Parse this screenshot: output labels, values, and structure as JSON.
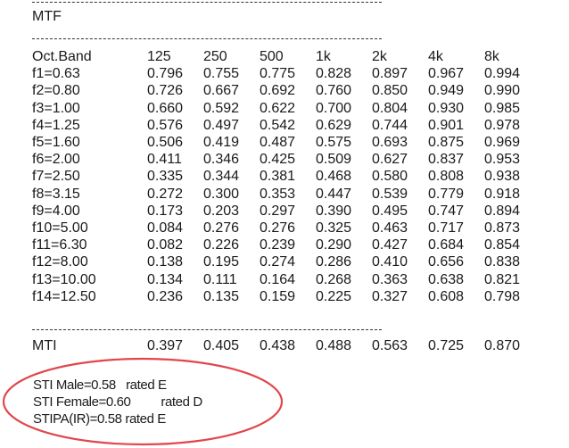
{
  "section_title": "MTF",
  "table": {
    "header": [
      "Oct.Band",
      "125",
      "250",
      "500",
      "1k",
      "2k",
      "4k",
      "8k"
    ],
    "rows": [
      [
        "f1=0.63",
        "0.796",
        "0.755",
        "0.775",
        "0.828",
        "0.897",
        "0.967",
        "0.994"
      ],
      [
        "f2=0.80",
        "0.726",
        "0.667",
        "0.692",
        "0.760",
        "0.850",
        "0.949",
        "0.990"
      ],
      [
        "f3=1.00",
        "0.660",
        "0.592",
        "0.622",
        "0.700",
        "0.804",
        "0.930",
        "0.985"
      ],
      [
        "f4=1.25",
        "0.576",
        "0.497",
        "0.542",
        "0.629",
        "0.744",
        "0.901",
        "0.978"
      ],
      [
        "f5=1.60",
        "0.506",
        "0.419",
        "0.487",
        "0.575",
        "0.693",
        "0.875",
        "0.969"
      ],
      [
        "f6=2.00",
        "0.411",
        "0.346",
        "0.425",
        "0.509",
        "0.627",
        "0.837",
        "0.953"
      ],
      [
        "f7=2.50",
        "0.335",
        "0.344",
        "0.381",
        "0.468",
        "0.580",
        "0.808",
        "0.938"
      ],
      [
        "f8=3.15",
        "0.272",
        "0.300",
        "0.353",
        "0.447",
        "0.539",
        "0.779",
        "0.918"
      ],
      [
        "f9=4.00",
        "0.173",
        "0.203",
        "0.297",
        "0.390",
        "0.495",
        "0.747",
        "0.894"
      ],
      [
        "f10=5.00",
        "0.084",
        "0.276",
        "0.276",
        "0.325",
        "0.463",
        "0.717",
        "0.873"
      ],
      [
        "f11=6.30",
        "0.082",
        "0.226",
        "0.239",
        "0.290",
        "0.427",
        "0.684",
        "0.854"
      ],
      [
        "f12=8.00",
        "0.138",
        "0.195",
        "0.274",
        "0.286",
        "0.410",
        "0.656",
        "0.838"
      ],
      [
        "f13=10.00",
        "0.134",
        "0.111",
        "0.164",
        "0.268",
        "0.363",
        "0.638",
        "0.821"
      ],
      [
        "f14=12.50",
        "0.236",
        "0.135",
        "0.159",
        "0.225",
        "0.327",
        "0.608",
        "0.798"
      ]
    ],
    "mti": [
      "MTI",
      "0.397",
      "0.405",
      "0.438",
      "0.488",
      "0.563",
      "0.725",
      "0.870"
    ]
  },
  "results": {
    "sti_male": "STI Male=0.58   rated E",
    "sti_female": "STI Female=0.60         rated D",
    "stipa": "STIPA(IR)=0.58 rated E"
  },
  "colors": {
    "highlight_ellipse": "#e0474c"
  }
}
